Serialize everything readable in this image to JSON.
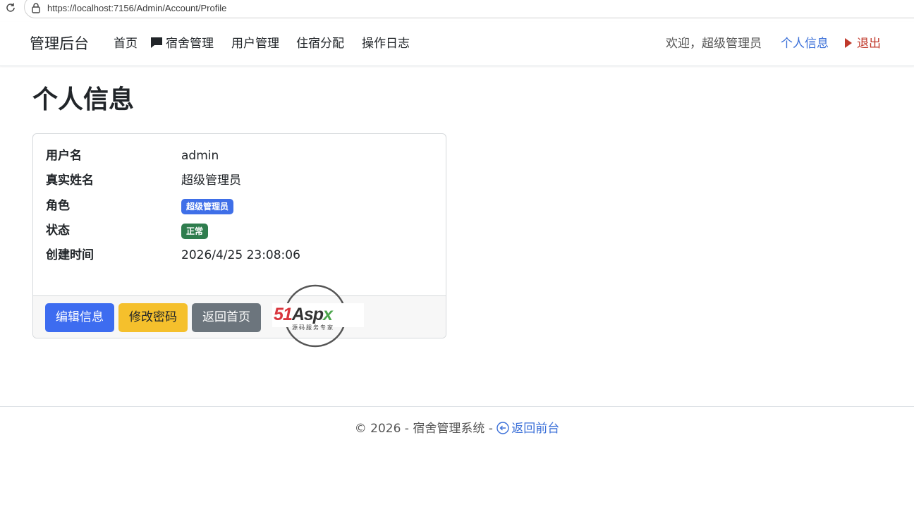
{
  "browser": {
    "url": "https://localhost:7156/Admin/Account/Profile"
  },
  "navbar": {
    "brand": "管理后台",
    "links": [
      {
        "label": "首页"
      },
      {
        "label": "宿舍管理",
        "icon": "chat-bubble-icon"
      },
      {
        "label": "用户管理"
      },
      {
        "label": "住宿分配"
      },
      {
        "label": "操作日志"
      }
    ],
    "welcome": "欢迎，超级管理员",
    "profile": "个人信息",
    "logout": "退出"
  },
  "page": {
    "title": "个人信息"
  },
  "profile": {
    "rows": [
      {
        "label": "用户名",
        "value": "admin"
      },
      {
        "label": "真实姓名",
        "value": "超级管理员"
      },
      {
        "label": "角色",
        "badge": "超级管理员"
      },
      {
        "label": "状态",
        "badge": "正常"
      },
      {
        "label": "创建时间",
        "value": "2026/4/25 23:08:06"
      }
    ],
    "buttons": {
      "edit": "编辑信息",
      "password": "修改密码",
      "home": "返回首页"
    }
  },
  "watermark": {
    "text_red": "51",
    "text_dark": "Asp",
    "text_green": "x",
    "subtitle": "源码服务专家"
  },
  "footer": {
    "copyright": "© 2026 - 宿舍管理系统 - ",
    "back_link": "返回前台"
  },
  "colors": {
    "primary": "#3d6cf0",
    "warning": "#f5c02c",
    "secondary": "#6c757d",
    "success": "#2f7d4e",
    "danger": "#c0392b",
    "link": "#3a6fd8"
  }
}
